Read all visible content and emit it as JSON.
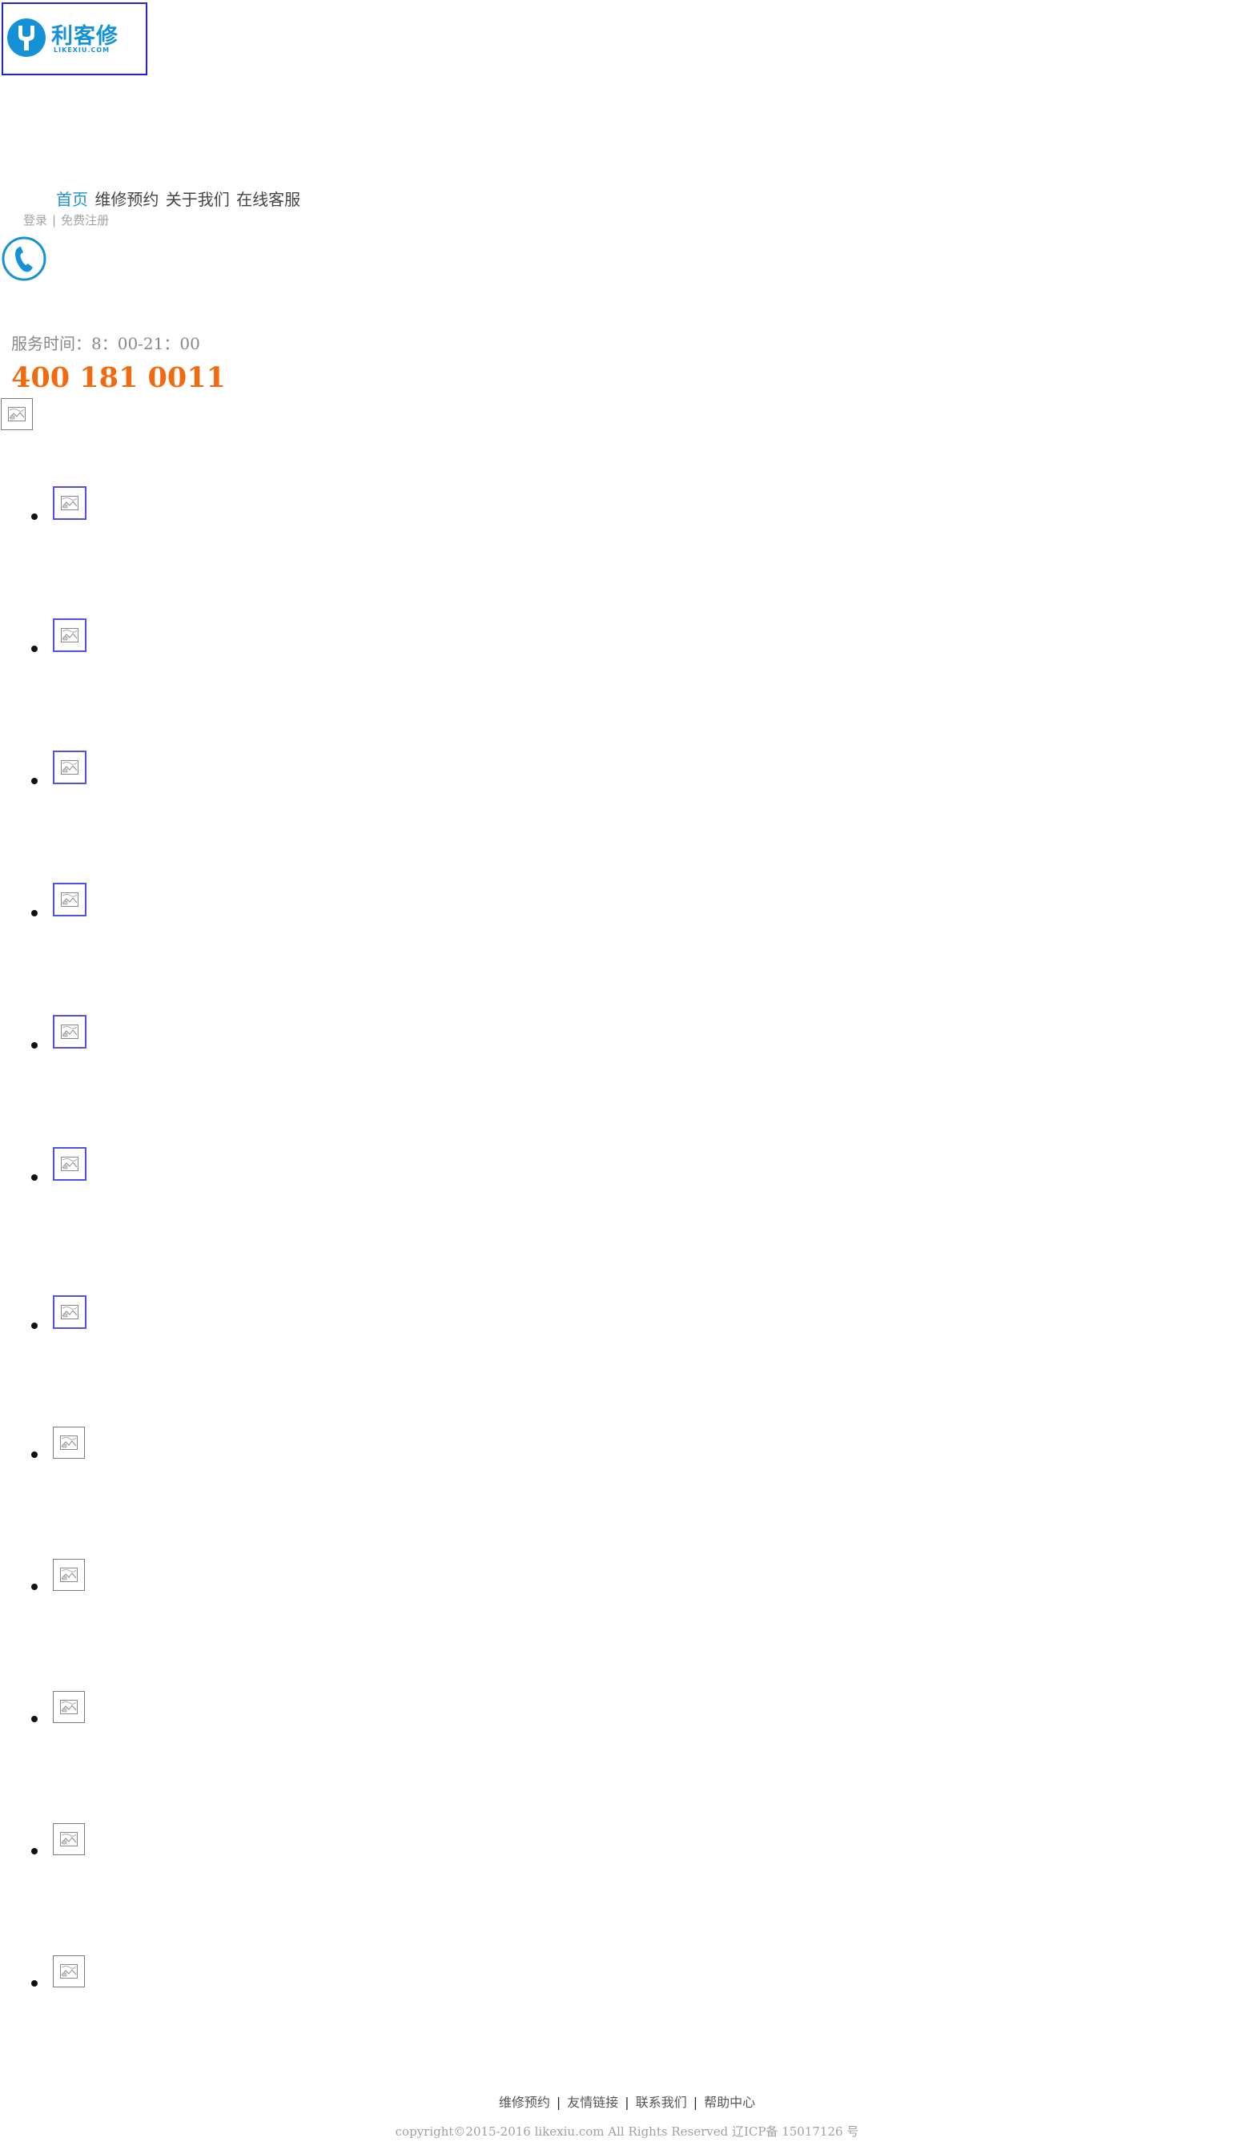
{
  "header": {
    "logo": {
      "text": "利客修",
      "subtext": "LIKEXIU.COM"
    },
    "nav": [
      {
        "label": "首页",
        "active": true
      },
      {
        "label": "维修预约",
        "active": false
      },
      {
        "label": "关于我们",
        "active": false
      },
      {
        "label": "在线客服",
        "active": false
      }
    ],
    "auth": {
      "login": "登录",
      "separator": "|",
      "register": "免费注册"
    },
    "service_hours": "服务时间：8：00-21：00",
    "hotline": "400 181 0011"
  },
  "colors": {
    "brand": "#1592d6",
    "hotline": "#f26a10",
    "nav_active": "#1e8fd6"
  },
  "icons": {
    "logo": "wrench-icon",
    "phone": "phone-icon",
    "broken_image": "broken-image-icon"
  },
  "footer": {
    "links": [
      "维修预约",
      "友情链接",
      "联系我们",
      "帮助中心"
    ],
    "separator": "|",
    "copyright": "copyright©2015-2016 likexiu.com All Rights Reserved 辽ICP备 15017126 号"
  }
}
